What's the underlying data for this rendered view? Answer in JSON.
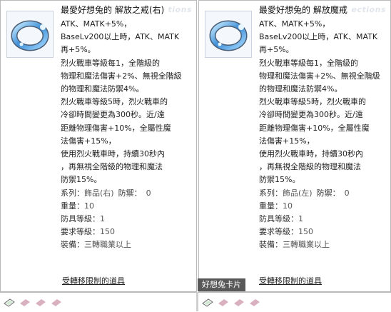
{
  "left_card": {
    "title": "最愛好想兔的 解放之戒(右)",
    "watermark": "tions",
    "lines": [
      "ATK、MATK+5%，",
      "BaseLv200以上時，ATK、MATK",
      "再+5%。",
      "烈火戰車等級每1，全階級的",
      "物理和魔法傷害+2%、無視全階級",
      "的物理和魔法防禦4%。",
      "烈火戰車等級5時，烈火戰車的",
      "冷卻時間變更為300秒。近/遠",
      "距離物理傷害+10%，全屬性魔",
      "法傷害+15%，",
      "使用烈火戰車時，持續30秒內",
      "，再無視全階級的物理和魔法",
      "防禦15%。"
    ],
    "stats": {
      "series_label": "系列：",
      "series_value": "飾品(右)",
      "defense_label": "防禦：",
      "defense_value": "0",
      "weight_label": "重量：",
      "weight_value": "10",
      "armor_level_label": "防具等級：",
      "armor_level_value": "1",
      "req_level_label": "要求等級：",
      "req_level_value": "150",
      "equip_label": "裝備：",
      "equip_value": "三轉職業以上"
    },
    "restrict_link": "受轉移限制的道具"
  },
  "right_card": {
    "title": "最愛好想兔的 解放魔戒",
    "watermark": "ections",
    "lines": [
      "ATK、MATK+5%，",
      "BaseLv200以上時，ATK、MATK",
      "再+5%。",
      "烈火戰車等級每1，全階級的",
      "物理和魔法傷害+2%、無視全階級",
      "的物理和魔法防禦4%。",
      "烈火戰車等級5時，烈火戰車的",
      "冷卻時間變更為300秒。近/遠",
      "距離物理傷害+10%，全屬性魔",
      "法傷害+15%，",
      "使用烈火戰車時，持續30秒內",
      "，再無視全階級的物理和魔法",
      "防禦15%。"
    ],
    "stats": {
      "series_label": "系列：",
      "series_value": "飾品(左)",
      "defense_label": "防禦：",
      "defense_value": "0",
      "weight_label": "重量：",
      "weight_value": "10",
      "armor_level_label": "防具等級：",
      "armor_level_value": "1",
      "req_level_label": "要求等級：",
      "req_level_value": "150",
      "equip_label": "裝備：",
      "equip_value": "三轉職業以上"
    },
    "restrict_link": "受轉移限制的道具"
  },
  "tooltip": {
    "text": "好想兔卡片"
  },
  "colors": {
    "ring_blue": "#4fa6e8",
    "tooltip_bg": "#585858",
    "card_slot": "#d9b0c0"
  }
}
